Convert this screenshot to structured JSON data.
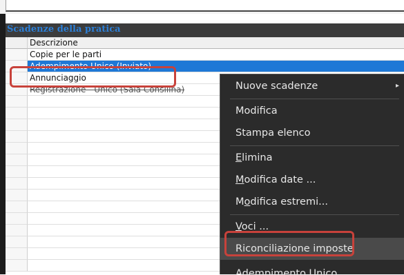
{
  "panel": {
    "title": "Scadenze della pratica"
  },
  "table": {
    "header": "Descrizione",
    "rows": [
      {
        "label": "Copie per le parti",
        "state": "normal"
      },
      {
        "label": "Adempimento Unico (Inviato)",
        "state": "selected"
      },
      {
        "label": "Annunciaggio",
        "state": "normal"
      },
      {
        "label": "Registrazione - Unico (Sala Consilina)",
        "state": "strikethrough"
      }
    ]
  },
  "context_menu": {
    "items": [
      {
        "label": "Nuove scadenze",
        "submenu": true,
        "arrow": "▸"
      },
      {
        "label": "Modifica"
      },
      {
        "label": "Stampa elenco"
      },
      {
        "label": "Elimina",
        "mnemonic": "E"
      },
      {
        "label": "Modifica date ...",
        "mnemonic": "M"
      },
      {
        "label": "Modifica estremi...",
        "mnemonic": "o"
      },
      {
        "label": "Voci ...",
        "mnemonic": "V"
      },
      {
        "label": "Riconciliazione imposte",
        "highlighted": true
      },
      {
        "label": "Adempimento Unico"
      }
    ]
  },
  "colors": {
    "selection": "#1e78d6",
    "callout": "#c8423b",
    "title": "#2c7fd6",
    "menu_bg": "#2b2b2b"
  }
}
